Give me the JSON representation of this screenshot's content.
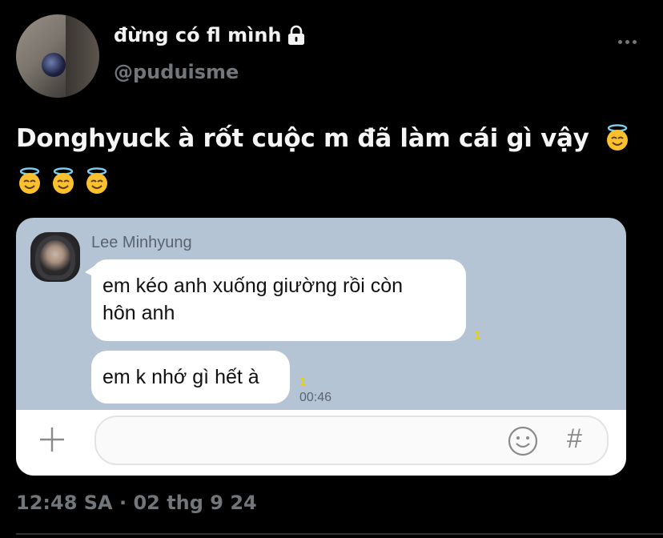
{
  "tweet": {
    "display_name": "đừng có fl mình",
    "handle": "@puduisme",
    "text": "Donghyuck à rốt cuộc m đã làm cái gì vậy",
    "emojis": [
      "smiling-face-with-halo",
      "smiling-face-with-halo",
      "smiling-face-with-halo",
      "smiling-face-with-halo"
    ],
    "timestamp": "12:48 SA · 02 thg 9 24"
  },
  "chat": {
    "sender": "Lee Minhyung",
    "messages": [
      {
        "text_line1": "em kéo anh xuống giường rồi còn",
        "text_line2": "hôn anh",
        "unread": "1"
      },
      {
        "text": "em k nhớ gì hết à",
        "unread": "1",
        "time": "00:46"
      }
    ],
    "input_placeholder": "",
    "hash_symbol": "#"
  },
  "colors": {
    "background": "#000000",
    "chat_bg": "#b4c4d4",
    "muted": "#71767b",
    "unread": "#e6d200"
  }
}
